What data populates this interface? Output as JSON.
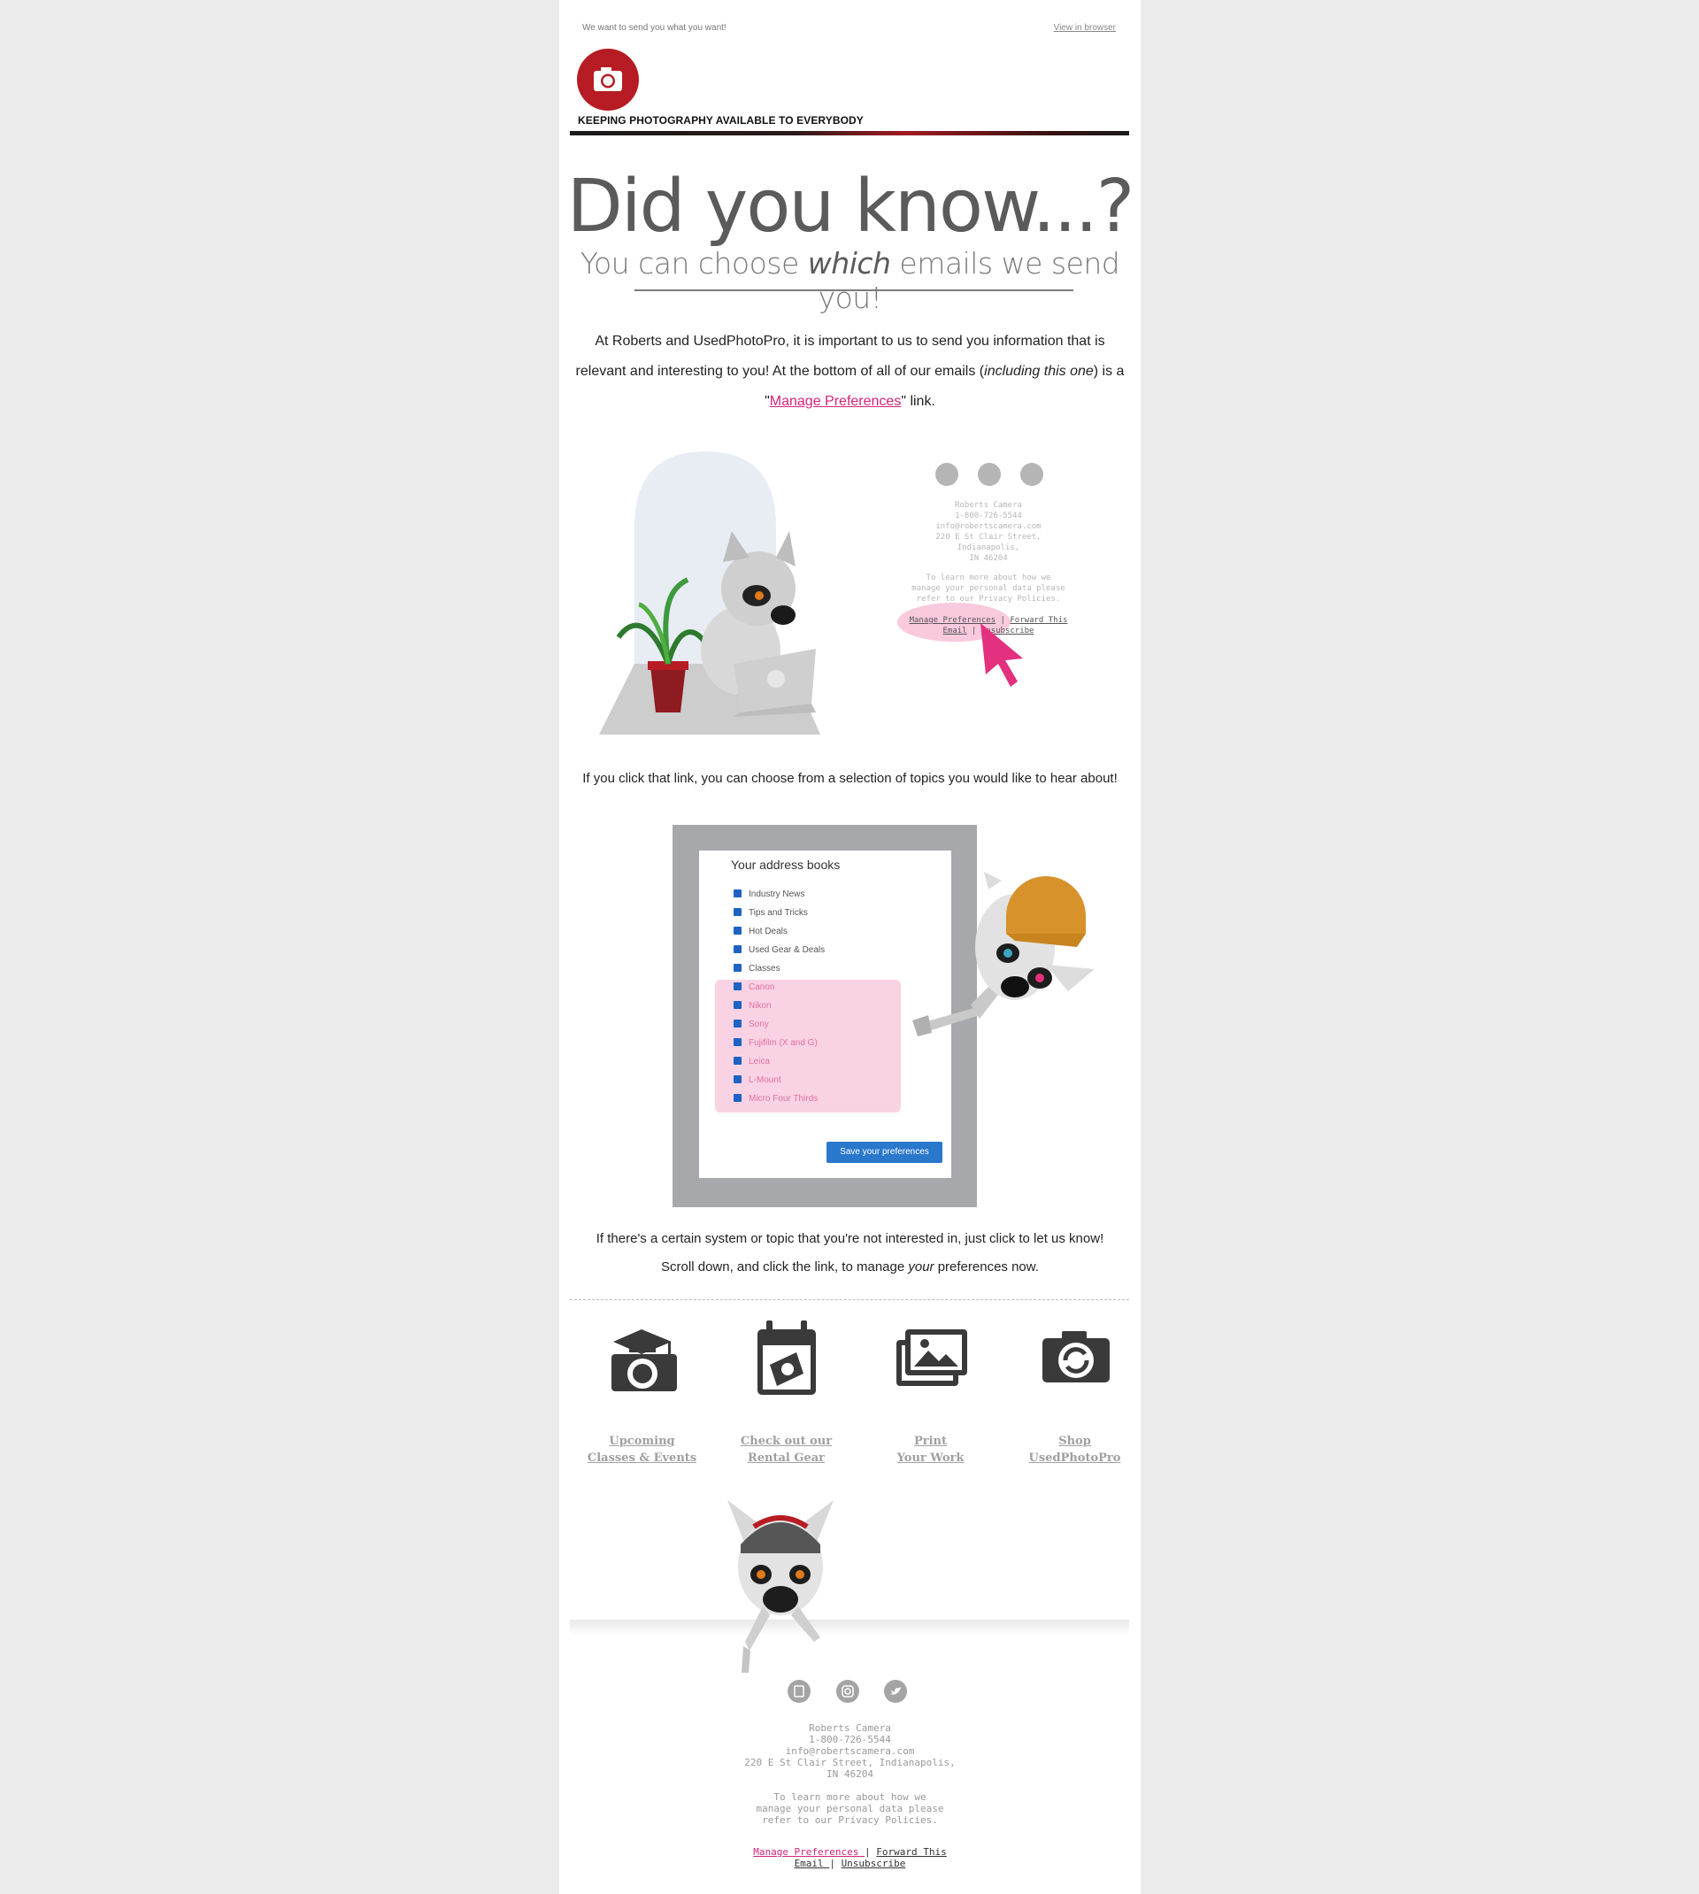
{
  "colors": {
    "brand_red": "#b71c24",
    "link_pink": "#d4237a",
    "background": "#ebebeb"
  },
  "header": {
    "preheader": "We want to send you what you want!",
    "view_in_browser": "View in browser",
    "logo_icon": "camera-icon",
    "tagline": "KEEPING PHOTOGRAPHY AVAILABLE TO EVERYBODY"
  },
  "hero": {
    "title": "Did you know...?",
    "subtitle_before": "You can choose ",
    "subtitle_emphasis": "which",
    "subtitle_after": " emails we send you!"
  },
  "intro": {
    "part1": "At Roberts and UsedPhotoPro, it is important to us to send you information that is relevant and interesting to you!  At the bottom of all of our emails (",
    "italic": "including this one",
    "part2": ") is a \"",
    "link": "Manage Preferences",
    "part3": "\" link."
  },
  "illustration_footer": {
    "social_icons": [
      "facebook-icon",
      "instagram-icon",
      "twitter-icon"
    ],
    "company": "Roberts Camera",
    "phone": "1-800-726-5544",
    "email": "info@robertscamera.com",
    "address1": "220 E St Clair Street, Indianapolis,",
    "address2": "IN 46204",
    "privacy1": "To learn more about how we",
    "privacy2": "manage your personal data please",
    "privacy3": "refer to our Privacy Policies.",
    "manage_link": "Manage Preferences",
    "forward_link": "Forward This",
    "forward_link2": "Email",
    "unsubscribe_link": "Unsubscribe"
  },
  "click_text": "If you click that link, you can choose from a selection of topics you would like to hear about!",
  "address_books": {
    "title": "Your address books",
    "items": [
      "Industry News",
      "Tips and Tricks",
      "Hot Deals",
      "Used Gear & Deals",
      "Classes",
      "Canon",
      "Nikon",
      "Sony",
      "Fujifilm (X and G)",
      "Leica",
      "L-Mount",
      "Micro Four Thirds"
    ],
    "save_button": "Save your preferences"
  },
  "outro": {
    "line1": "If there's a certain system or topic that you're not interested in, just click to let us know!",
    "line2_before": "Scroll down, and click the link, to manage ",
    "line2_italic": "your",
    "line2_after": " preferences now."
  },
  "icon_links": [
    {
      "icon": "graduation-camera-icon",
      "line1": "Upcoming",
      "line2": "Classes & Events"
    },
    {
      "icon": "calendar-camera-icon",
      "line1": "Check out our",
      "line2": "Rental Gear"
    },
    {
      "icon": "print-photos-icon",
      "line1": "Print",
      "line2": "Your Work"
    },
    {
      "icon": "recycle-camera-icon",
      "line1": "Shop",
      "line2": "UsedPhotoPro"
    }
  ],
  "footer": {
    "social_icons": [
      "facebook-icon",
      "instagram-icon",
      "twitter-icon"
    ],
    "company": "Roberts Camera",
    "phone": "1-800-726-5544",
    "email": "info@robertscamera.com",
    "address1": "220 E St Clair Street, Indianapolis,",
    "address2": "IN 46204",
    "privacy1": "To learn more about how we",
    "privacy2": "manage your personal data please",
    "privacy3": "refer to our Privacy Policies.",
    "manage_link": "Manage Preferences ",
    "forward_link": "Forward This",
    "forward_link2": "Email ",
    "unsubscribe_link": "Unsubscribe"
  }
}
